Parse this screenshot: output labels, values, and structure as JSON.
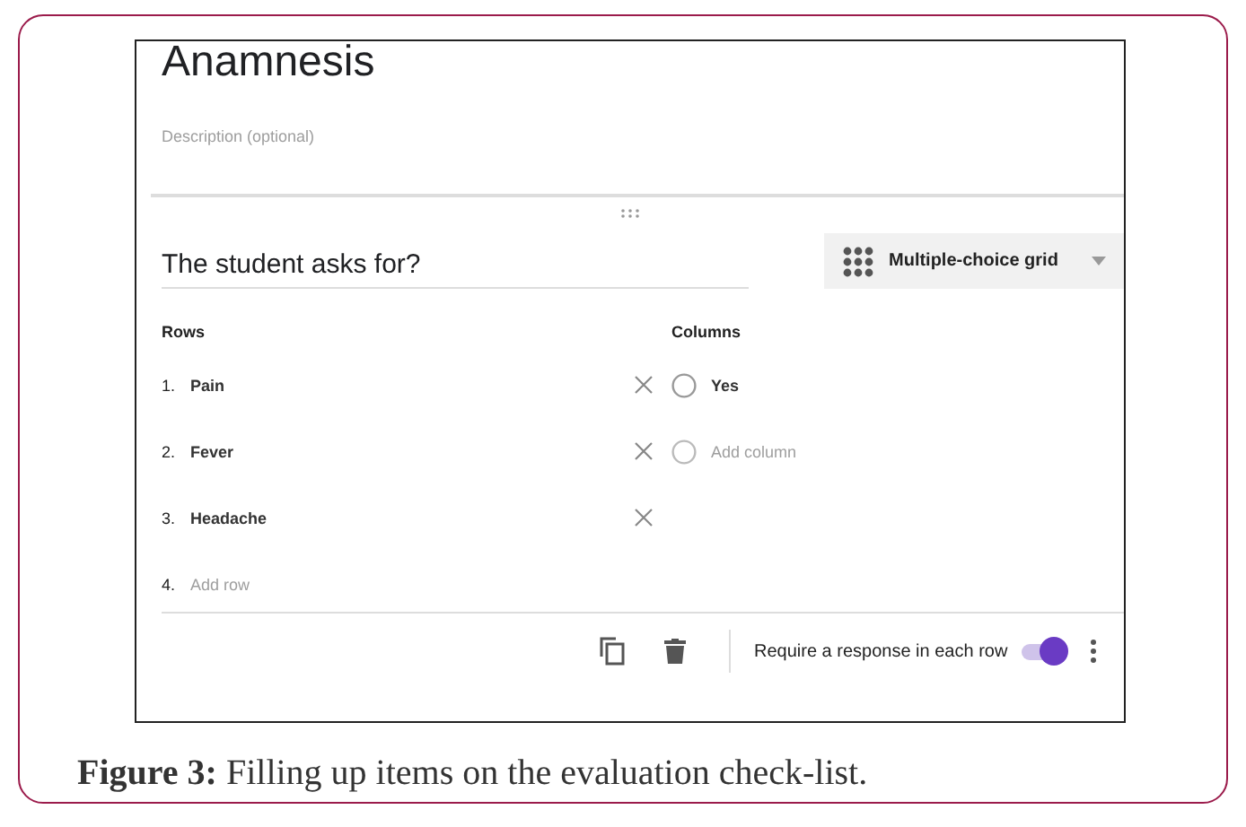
{
  "form": {
    "title": "Anamnesis",
    "description_placeholder": "Description (optional)"
  },
  "question": {
    "title": "The student asks for?",
    "type": "Multiple-choice grid"
  },
  "rows": {
    "label": "Rows",
    "items": [
      {
        "number": "1.",
        "text": "Pain"
      },
      {
        "number": "2.",
        "text": "Fever"
      },
      {
        "number": "3.",
        "text": "Headache"
      }
    ],
    "add": {
      "number": "4.",
      "placeholder": "Add row"
    }
  },
  "columns": {
    "label": "Columns",
    "items": [
      {
        "text": "Yes"
      }
    ],
    "add": {
      "placeholder": "Add column"
    }
  },
  "footer": {
    "required_label": "Require a response in each row",
    "required_on": true
  },
  "caption": "**Figure 3:** Filling up items on the evaluation check-list."
}
